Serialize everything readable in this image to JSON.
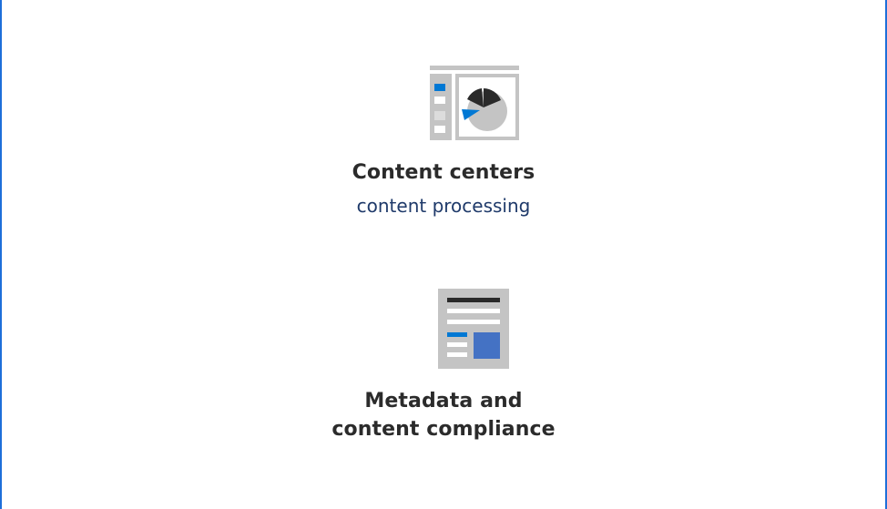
{
  "colors": {
    "border": "#1e6fd9",
    "accent_blue": "#0078d4",
    "accent_dark": "#2a2a2a",
    "icon_gray": "#c4c4c4",
    "title_text": "#2b2b2b",
    "subtitle_text": "#1f3a6a"
  },
  "items": [
    {
      "title": "Content centers",
      "subtitle": "content processing",
      "icon": "content-center-pie-chart-icon"
    },
    {
      "title_line1": "Metadata and",
      "title_line2": "content compliance",
      "icon": "metadata-document-icon"
    }
  ]
}
